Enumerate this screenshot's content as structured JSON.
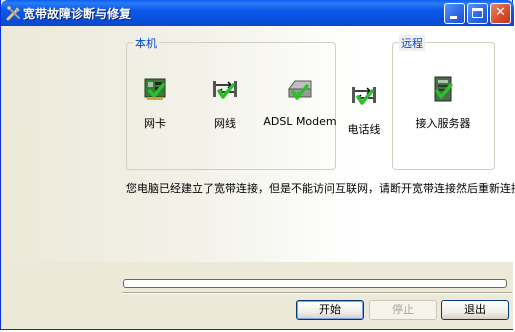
{
  "window": {
    "title": "宽带故障诊断与修复"
  },
  "local_group": {
    "label": "本机",
    "devices": [
      {
        "label": "网卡",
        "icon": "network-card-icon"
      },
      {
        "label": "网线",
        "icon": "network-cable-icon"
      },
      {
        "label": "ADSL Modem",
        "icon": "adsl-modem-icon"
      }
    ]
  },
  "phone_line": {
    "label": "电话线",
    "icon": "phone-line-icon"
  },
  "remote_group": {
    "label": "远程",
    "devices": [
      {
        "label": "接入服务器",
        "icon": "access-server-icon"
      }
    ]
  },
  "status": {
    "message": "您电脑已经建立了宽带连接，但是不能访问互联网，请断开宽带连接然后重新连接。"
  },
  "progress": {
    "value": 0
  },
  "buttons": {
    "start": "开始",
    "stop": "停止",
    "exit": "退出"
  },
  "colors": {
    "accent": "#0046d5",
    "check": "#2bc02b",
    "title_bar": "#0a58ea"
  }
}
